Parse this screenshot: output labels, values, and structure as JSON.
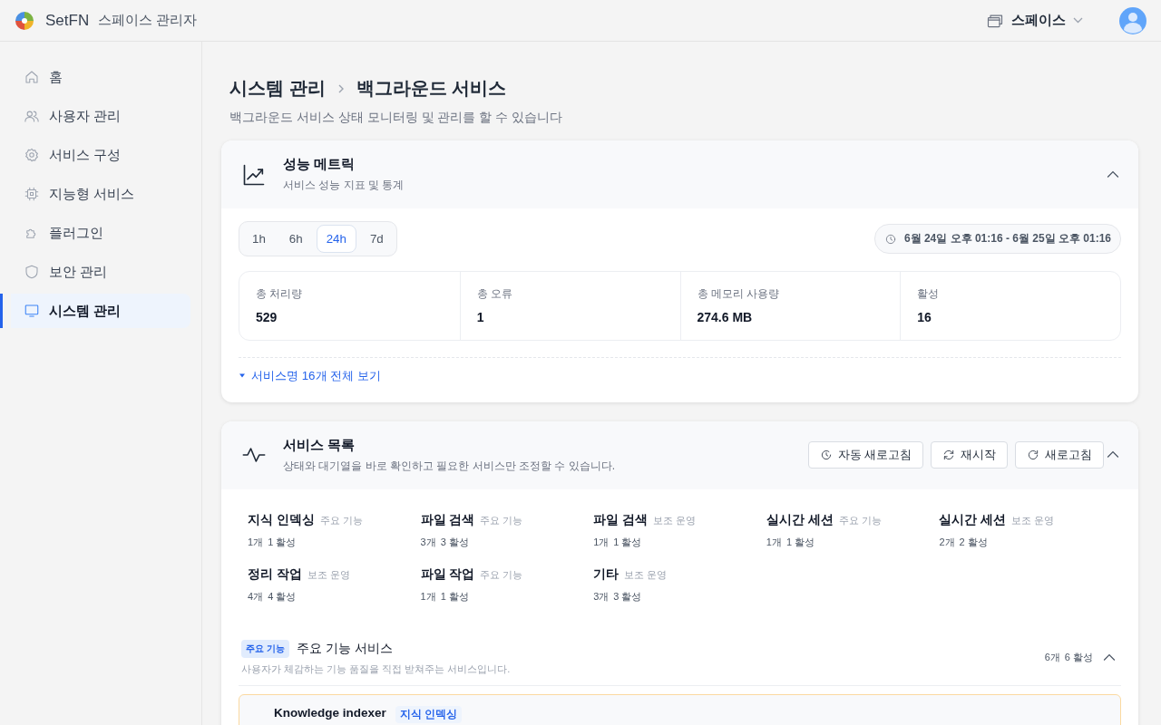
{
  "header": {
    "brand": "SetFN",
    "app_title": "스페이스 관리자",
    "space_selector": "스페이스"
  },
  "sidebar": {
    "items": [
      {
        "label": "홈",
        "selected": false
      },
      {
        "label": "사용자 관리",
        "selected": false
      },
      {
        "label": "서비스 구성",
        "selected": false
      },
      {
        "label": "지능형 서비스",
        "selected": false
      },
      {
        "label": "플러그인",
        "selected": false
      },
      {
        "label": "보안 관리",
        "selected": false
      },
      {
        "label": "시스템 관리",
        "selected": true
      }
    ]
  },
  "breadcrumb": [
    "시스템 관리",
    "백그라운드 서비스"
  ],
  "page_subtitle": "백그라운드 서비스 상태 모니터링 및 관리를 할 수 있습니다",
  "metrics_card": {
    "title": "성능 메트릭",
    "subtitle": "서비스 성능 지표 및 통계",
    "expanded": true,
    "ranges": [
      {
        "label": "1h",
        "selected": false
      },
      {
        "label": "6h",
        "selected": false
      },
      {
        "label": "24h",
        "selected": true
      },
      {
        "label": "7d",
        "selected": false
      }
    ],
    "date_range": "6월 24일 오후 01:16 - 6월 25일 오후 01:16",
    "stats": [
      {
        "label": "총 처리량",
        "value": "529"
      },
      {
        "label": "총 오류",
        "value": "1"
      },
      {
        "label": "총 메모리 사용량",
        "value": "274.6 MB"
      },
      {
        "label": "활성",
        "value": "16"
      }
    ],
    "names_toggle": {
      "label": "서비스명 16개 전체 보기",
      "expanded": false
    }
  },
  "services_card": {
    "title": "서비스 목록",
    "subtitle": "상태와 대기열을 바로 확인하고 필요한 서비스만 조정할 수 있습니다.",
    "expanded": true,
    "buttons": [
      {
        "kind": "auto",
        "label": "자동 새로고침"
      },
      {
        "kind": "restart",
        "label": "재시작"
      },
      {
        "kind": "refresh",
        "label": "새로고침"
      }
    ],
    "groups": [
      {
        "name": "지식 인덱싱",
        "tier": "주요 기능",
        "count": "1개",
        "active": "1 활성"
      },
      {
        "name": "파일 검색",
        "tier": "주요 기능",
        "count": "3개",
        "active": "3 활성"
      },
      {
        "name": "파일 검색",
        "tier": "보조 운영",
        "count": "1개",
        "active": "1 활성"
      },
      {
        "name": "실시간 세션",
        "tier": "주요 기능",
        "count": "1개",
        "active": "1 활성"
      },
      {
        "name": "실시간 세션",
        "tier": "보조 운영",
        "count": "2개",
        "active": "2 활성"
      },
      {
        "name": "정리 작업",
        "tier": "보조 운영",
        "count": "4개",
        "active": "4 활성"
      },
      {
        "name": "파일 작업",
        "tier": "주요 기능",
        "count": "1개",
        "active": "1 활성"
      },
      {
        "name": "기타",
        "tier": "보조 운영",
        "count": "3개",
        "active": "3 활성"
      }
    ],
    "section": {
      "badge": "주요 기능",
      "title": "주요 기능 서비스",
      "description": "사용자가 체감하는 기능 품질을 직접 받쳐주는 서비스입니다.",
      "count": "6개",
      "active": "6 활성",
      "expanded": true,
      "services": [
        {
          "name": "Knowledge indexer",
          "tag": "지식 인덱싱"
        }
      ]
    }
  }
}
